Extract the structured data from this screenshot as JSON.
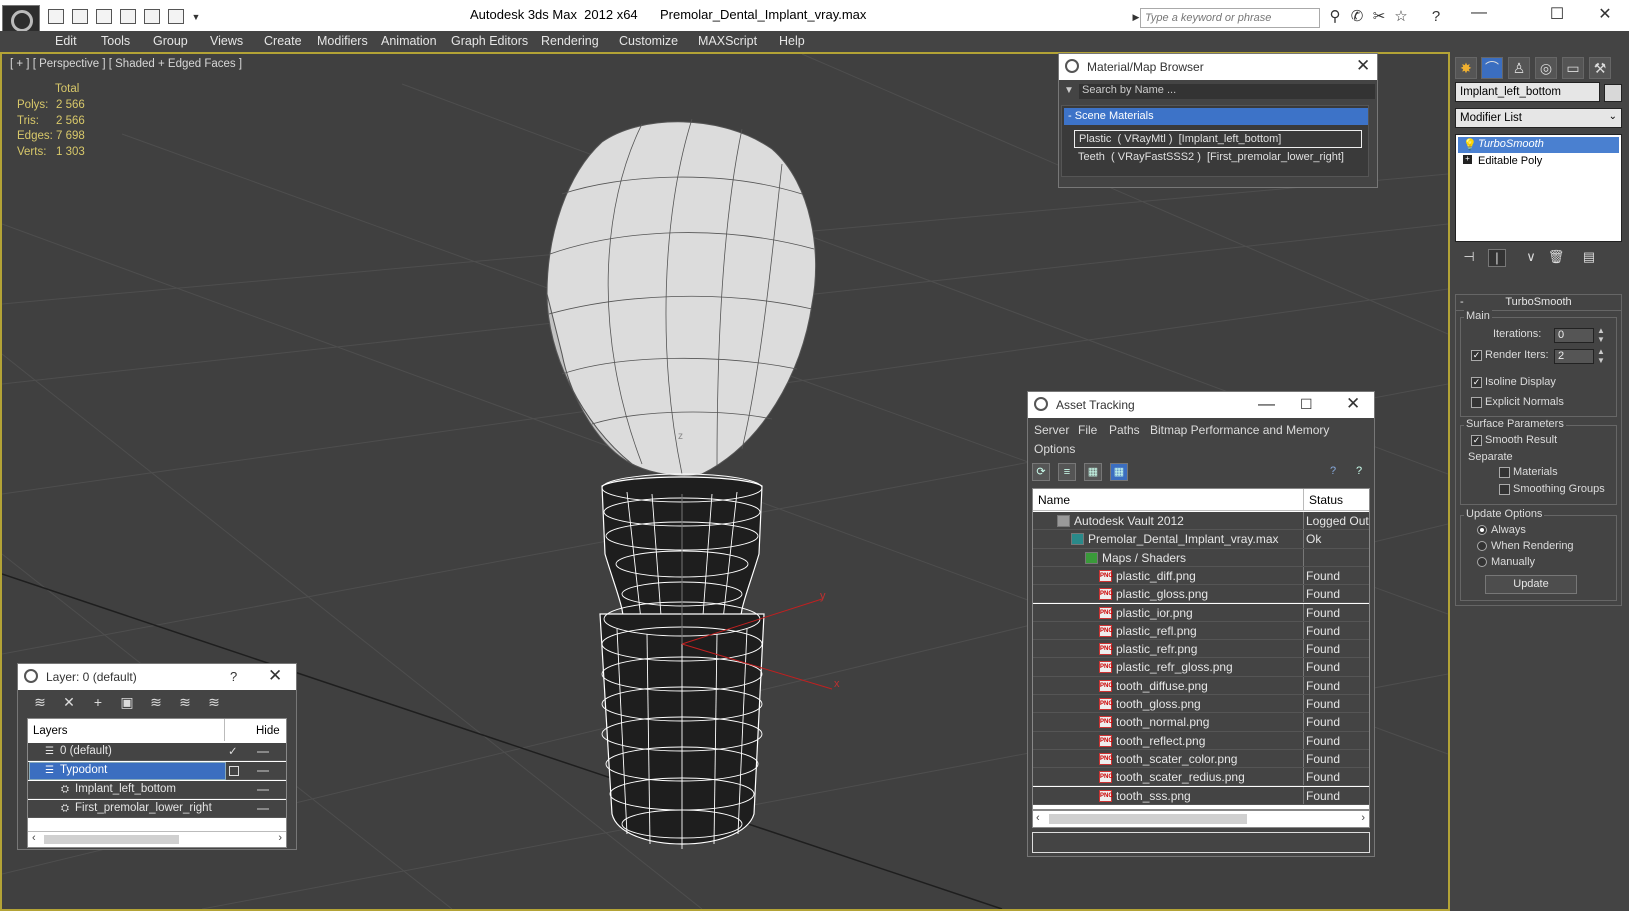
{
  "titlebar": {
    "title": "Autodesk 3ds Max  2012 x64",
    "filename": "Premolar_Dental_Implant_vray.max",
    "search_placeholder": "Type a keyword or phrase"
  },
  "menu": [
    "Edit",
    "Tools",
    "Group",
    "Views",
    "Create",
    "Modifiers",
    "Animation",
    "Graph Editors",
    "Rendering",
    "Customize",
    "MAXScript",
    "Help"
  ],
  "viewport": {
    "label": "[ + ] [ Perspective ] [ Shaded + Edged Faces ]",
    "stats_header": "Total",
    "stats": [
      {
        "label": "Polys:",
        "value": "2 566"
      },
      {
        "label": "Tris:",
        "value": "2 566"
      },
      {
        "label": "Edges:",
        "value": "7 698"
      },
      {
        "label": "Verts:",
        "value": "1 303"
      }
    ],
    "axis_x": "x",
    "axis_y": "y",
    "axis_z": "z"
  },
  "command_panel": {
    "object_name": "Implant_left_bottom",
    "modifier_list": "Modifier List",
    "stack": [
      "TurboSmooth",
      "Editable Poly"
    ],
    "rollout_title": "TurboSmooth",
    "main_label": "Main",
    "iterations_label": "Iterations:",
    "iterations_value": "0",
    "render_iters_label": "Render Iters:",
    "render_iters_value": "2",
    "isoline_label": "Isoline Display",
    "explicit_normals_label": "Explicit Normals",
    "surface_params_label": "Surface Parameters",
    "smooth_result_label": "Smooth Result",
    "separate_label": "Separate",
    "materials_label": "Materials",
    "smoothing_groups_label": "Smoothing Groups",
    "update_options_label": "Update Options",
    "always_label": "Always",
    "when_rendering_label": "When Rendering",
    "manually_label": "Manually",
    "update_button": "Update"
  },
  "material_browser": {
    "title": "Material/Map Browser",
    "search_placeholder": "Search by Name ...",
    "section": "- Scene Materials",
    "rows": [
      "Plastic  ( VRayMtl )  [Implant_left_bottom]",
      "Teeth  ( VRayFastSSS2 )  [First_premolar_lower_right]"
    ]
  },
  "asset_tracking": {
    "title": "Asset Tracking",
    "menu": [
      "Server",
      "File",
      "Paths",
      "Bitmap Performance and Memory",
      "Options"
    ],
    "col_name": "Name",
    "col_status": "Status",
    "rows": [
      {
        "name": "Autodesk Vault 2012",
        "status": "Logged Out",
        "indent": 1,
        "icon": "vault-icon"
      },
      {
        "name": "Premolar_Dental_Implant_vray.max",
        "status": "Ok",
        "indent": 2,
        "icon": "max-file-icon"
      },
      {
        "name": "Maps / Shaders",
        "status": "",
        "indent": 3,
        "icon": "maps-folder-icon"
      },
      {
        "name": "plastic_diff.png",
        "status": "Found",
        "indent": 4,
        "icon": "png-icon"
      },
      {
        "name": "plastic_gloss.png",
        "status": "Found",
        "indent": 4,
        "icon": "png-icon"
      },
      {
        "name": "plastic_ior.png",
        "status": "Found",
        "indent": 4,
        "icon": "png-icon"
      },
      {
        "name": "plastic_refl.png",
        "status": "Found",
        "indent": 4,
        "icon": "png-icon"
      },
      {
        "name": "plastic_refr.png",
        "status": "Found",
        "indent": 4,
        "icon": "png-icon"
      },
      {
        "name": "plastic_refr_gloss.png",
        "status": "Found",
        "indent": 4,
        "icon": "png-icon"
      },
      {
        "name": "tooth_diffuse.png",
        "status": "Found",
        "indent": 4,
        "icon": "png-icon"
      },
      {
        "name": "tooth_gloss.png",
        "status": "Found",
        "indent": 4,
        "icon": "png-icon"
      },
      {
        "name": "tooth_normal.png",
        "status": "Found",
        "indent": 4,
        "icon": "png-icon"
      },
      {
        "name": "tooth_reflect.png",
        "status": "Found",
        "indent": 4,
        "icon": "png-icon"
      },
      {
        "name": "tooth_scater_color.png",
        "status": "Found",
        "indent": 4,
        "icon": "png-icon"
      },
      {
        "name": "tooth_scater_redius.png",
        "status": "Found",
        "indent": 4,
        "icon": "png-icon"
      },
      {
        "name": "tooth_sss.png",
        "status": "Found",
        "indent": 4,
        "icon": "png-icon"
      }
    ]
  },
  "layer_manager": {
    "title": "Layer: 0 (default)",
    "help": "?",
    "col_layers": "Layers",
    "col_hide": "Hide",
    "rows": [
      {
        "name": "0 (default)",
        "indent": 1
      },
      {
        "name": "Typodont",
        "indent": 1
      },
      {
        "name": "Implant_left_bottom",
        "indent": 2
      },
      {
        "name": "First_premolar_lower_right",
        "indent": 2
      }
    ]
  }
}
